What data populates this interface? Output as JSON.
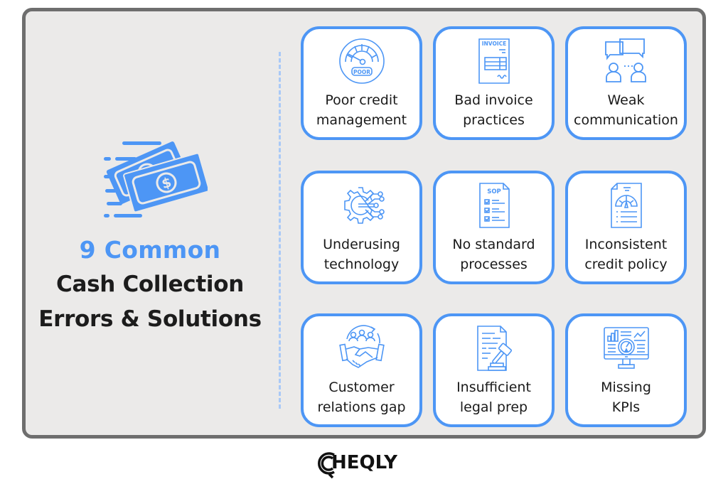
{
  "colors": {
    "accent": "#4d96f5",
    "frame_border": "#6e6e6e",
    "frame_bg": "#ebeae9",
    "divider": "#a9c9f7",
    "title_dark": "#1c1c1c"
  },
  "header": {
    "icon": "money-bills-icon",
    "title_line1": "9 Common",
    "title_line2": "Cash Collection",
    "title_line3": "Errors & Solutions"
  },
  "cards": [
    {
      "icon": "credit-score-gauge-icon",
      "icon_text": "POOR",
      "line1": "Poor credit",
      "line2": "management"
    },
    {
      "icon": "invoice-document-icon",
      "icon_text": "INVOICE",
      "line1": "Bad invoice",
      "line2": "practices"
    },
    {
      "icon": "chat-people-icon",
      "line1": "Weak",
      "line2": "communication"
    },
    {
      "icon": "gear-circuit-icon",
      "line1": "Underusing",
      "line2": "technology"
    },
    {
      "icon": "sop-checklist-icon",
      "icon_text": "SOP",
      "line1": "No standard",
      "line2": "processes"
    },
    {
      "icon": "credit-policy-document-icon",
      "line1": "Inconsistent",
      "line2": "credit policy"
    },
    {
      "icon": "handshake-team-icon",
      "line1": "Customer",
      "line2": "relations gap"
    },
    {
      "icon": "legal-gavel-document-icon",
      "line1": "Insufficient",
      "line2": "legal prep"
    },
    {
      "icon": "kpi-dashboard-monitor-icon",
      "line1": "Missing",
      "line2": "KPIs"
    }
  ],
  "footer": {
    "logo_text": "HEQLY",
    "logo_full": "CHEQLY"
  }
}
